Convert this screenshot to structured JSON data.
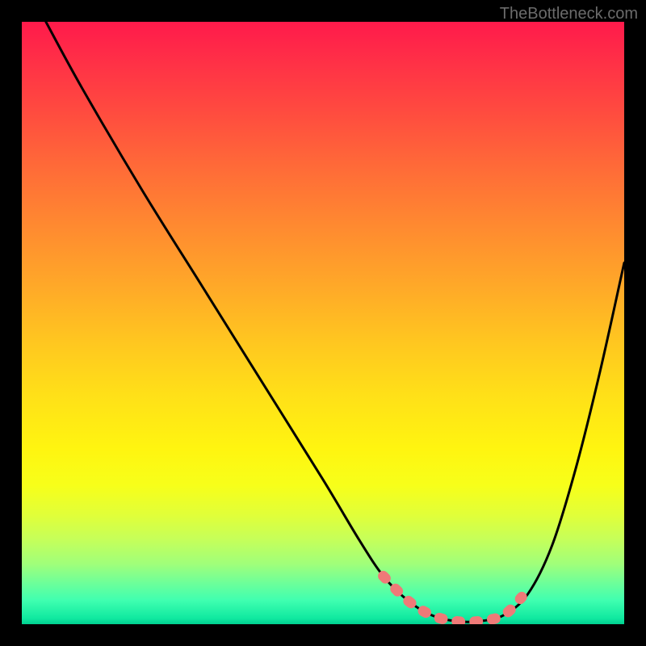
{
  "watermark": "TheBottleneck.com",
  "chart_data": {
    "type": "line",
    "title": "",
    "xlabel": "",
    "ylabel": "",
    "xlim": [
      0,
      100
    ],
    "ylim": [
      0,
      100
    ],
    "series": [
      {
        "name": "bottleneck-curve",
        "x": [
          4,
          10,
          20,
          30,
          40,
          50,
          56,
          60,
          64,
          68,
          72,
          76,
          80,
          84,
          88,
          92,
          96,
          100
        ],
        "y": [
          100,
          89,
          72,
          56,
          40,
          24,
          14,
          8,
          4,
          1.5,
          0.5,
          0.5,
          1.5,
          5,
          13,
          26,
          42,
          60
        ]
      }
    ],
    "highlight_segment": {
      "name": "optimal-range",
      "x": [
        60,
        64,
        68,
        72,
        76,
        80,
        83
      ],
      "y": [
        8,
        4,
        1.5,
        0.5,
        0.5,
        1.5,
        4.5
      ]
    },
    "background_gradient": {
      "top": "#ff1a4b",
      "middle": "#ffe018",
      "bottom": "#00d090"
    }
  }
}
